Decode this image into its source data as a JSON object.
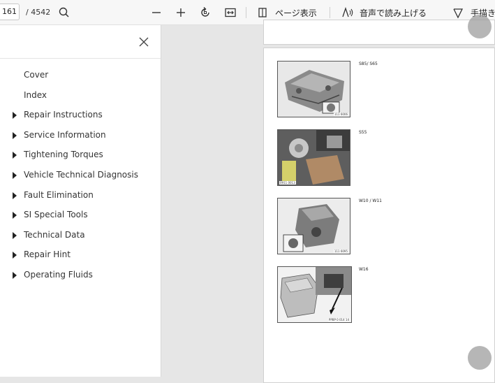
{
  "toolbar": {
    "page_number": "161",
    "page_total": "/ 4542",
    "page_view_label": "ページ表示",
    "read_aloud_label": "音声で読み上げる",
    "draw_label": "手描き"
  },
  "outline": {
    "items": [
      {
        "label": "Cover",
        "expandable": false
      },
      {
        "label": "Index",
        "expandable": false
      },
      {
        "label": "Repair Instructions",
        "expandable": true
      },
      {
        "label": "Service Information",
        "expandable": true
      },
      {
        "label": "Tightening Torques",
        "expandable": true
      },
      {
        "label": "Vehicle Technical Diagnosis",
        "expandable": true
      },
      {
        "label": "Fault Elimination",
        "expandable": true
      },
      {
        "label": "SI Special Tools",
        "expandable": true
      },
      {
        "label": "Technical Data",
        "expandable": true
      },
      {
        "label": "Repair Hint",
        "expandable": true
      },
      {
        "label": "Operating Fluids",
        "expandable": true
      }
    ]
  },
  "document": {
    "figures": [
      {
        "label": "S85/ S65",
        "code": "111 6006"
      },
      {
        "label": "S55",
        "code": "0911 0013"
      },
      {
        "label": "W10 / W11",
        "code": "111 6095"
      },
      {
        "label": "W16",
        "code": "PPBP 0 014 14"
      }
    ]
  }
}
